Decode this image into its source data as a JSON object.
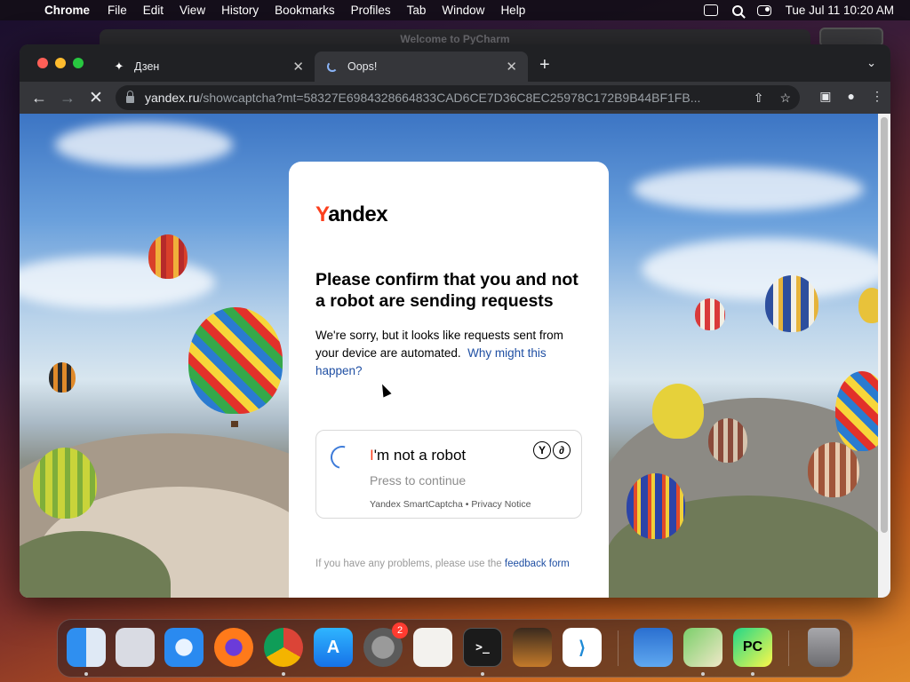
{
  "menubar": {
    "app": "Chrome",
    "items": [
      "File",
      "Edit",
      "View",
      "History",
      "Bookmarks",
      "Profiles",
      "Tab",
      "Window",
      "Help"
    ],
    "datetime": "Tue Jul 11  10:20 AM"
  },
  "background_window": {
    "title": "Welcome to PyCharm"
  },
  "browser": {
    "tabs": [
      {
        "title": "Дзен",
        "close": "✕"
      },
      {
        "title": "Oops!",
        "close": "✕"
      }
    ],
    "new_tab": "+",
    "url_host": "yandex.ru",
    "url_path": "/showcaptcha?mt=58327E6984328664833CAD6CE7D36C8EC25978C172B9B44BF1FB..."
  },
  "captcha": {
    "logo_first": "Y",
    "logo_rest": "andex",
    "heading": "Please confirm that you and not a robot are sending requests",
    "description": "We're sorry, but it looks like requests sent from your device are automated.",
    "why_link": "Why might this happen?",
    "robot_title_i": "I",
    "robot_title_rest": "'m not a robot",
    "robot_subtitle": "Press to continue",
    "robot_footer": "Yandex SmartCaptcha • Privacy Notice",
    "feedback_text": "If you have any problems, please use the ",
    "feedback_link": "feedback form"
  },
  "dock": {
    "apps": [
      "finder-icon",
      "launchpad-icon",
      "safari-icon",
      "firefox-icon",
      "chrome-icon",
      "app-store-icon",
      "system-settings-icon",
      "textedit-icon",
      "terminal-icon",
      "garageband-icon",
      "vscode-icon",
      "weather-icon",
      "maps-icon",
      "pycharm-icon",
      "trash-icon"
    ],
    "settings_badge": "2",
    "pycharm_label": "PC",
    "terminal_label": ">_"
  },
  "colors": {
    "yandex_red": "#fc3f1d",
    "link_blue": "#1f4fa3",
    "chrome_dark": "#35363a"
  }
}
